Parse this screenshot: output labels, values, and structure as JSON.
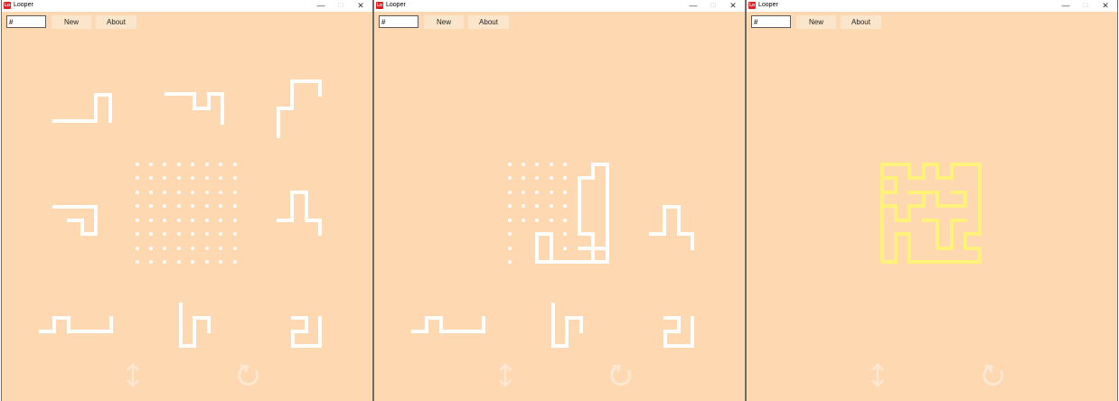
{
  "app": {
    "title": "Looper",
    "icon_label": "Lo",
    "controls": {
      "minimize": "—",
      "maximize": "□",
      "close": "✕"
    }
  },
  "toolbar": {
    "input_value": "#",
    "new_label": "New",
    "about_label": "About"
  },
  "colors": {
    "board": "#fdd8b0",
    "piece": "#ffffff",
    "solved": "#fff27a",
    "controls_faded": "#fbe8d4"
  },
  "icons": [
    "flip-vertical-icon",
    "rotate-icon"
  ],
  "windows": [
    {
      "state": "unsolved"
    },
    {
      "state": "in-progress"
    },
    {
      "state": "solved"
    }
  ]
}
